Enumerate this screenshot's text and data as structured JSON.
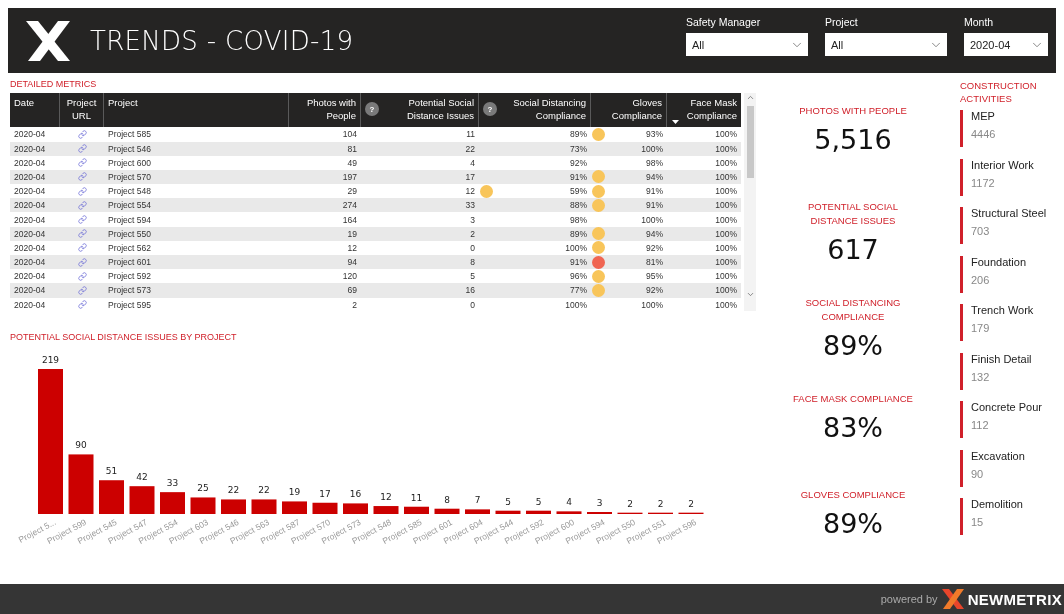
{
  "header": {
    "title": "TRENDS - COVID-19"
  },
  "filters": [
    {
      "label": "Safety Manager",
      "value": "All"
    },
    {
      "label": "Project",
      "value": "All"
    },
    {
      "label": "Month",
      "value": "2020-04"
    }
  ],
  "detailed_metrics": {
    "title": "DETAILED METRICS",
    "columns": [
      {
        "label": "Date",
        "sorted": false
      },
      {
        "label": "Project URL",
        "sorted": false
      },
      {
        "label": "Project",
        "sorted": false
      },
      {
        "label": "Photos with People",
        "sorted": false
      },
      {
        "label": "Potential Social Distance Issues",
        "help": "?",
        "sorted": false
      },
      {
        "label": "Social Distancing Compliance",
        "help": "?",
        "sorted": false
      },
      {
        "label": "Gloves Compliance",
        "sorted": false
      },
      {
        "label": "Face Mask Compliance",
        "sorted": true
      }
    ],
    "rows": [
      {
        "date": "2020-04",
        "project": "Project 585",
        "photos": "104",
        "issues": "11",
        "social_distancing": {
          "text": "89%"
        },
        "gloves": {
          "text": "93%",
          "color": "#f8c55a"
        },
        "face_mask": "100%"
      },
      {
        "date": "2020-04",
        "project": "Project 546",
        "photos": "81",
        "issues": "22",
        "social_distancing": {
          "text": "73%"
        },
        "gloves": {
          "text": "100%"
        },
        "face_mask": "100%"
      },
      {
        "date": "2020-04",
        "project": "Project 600",
        "photos": "49",
        "issues": "4",
        "social_distancing": {
          "text": "92%"
        },
        "gloves": {
          "text": "98%"
        },
        "face_mask": "100%"
      },
      {
        "date": "2020-04",
        "project": "Project 570",
        "photos": "197",
        "issues": "17",
        "social_distancing": {
          "text": "91%"
        },
        "gloves": {
          "text": "94%",
          "color": "#f8c55a"
        },
        "face_mask": "100%"
      },
      {
        "date": "2020-04",
        "project": "Project 548",
        "photos": "29",
        "issues": "12",
        "social_distancing": {
          "text": "59%",
          "color": "#f8c55a"
        },
        "gloves": {
          "text": "91%",
          "color": "#f8c55a"
        },
        "face_mask": "100%"
      },
      {
        "date": "2020-04",
        "project": "Project 554",
        "photos": "274",
        "issues": "33",
        "social_distancing": {
          "text": "88%"
        },
        "gloves": {
          "text": "91%",
          "color": "#f8c55a"
        },
        "face_mask": "100%"
      },
      {
        "date": "2020-04",
        "project": "Project 594",
        "photos": "164",
        "issues": "3",
        "social_distancing": {
          "text": "98%"
        },
        "gloves": {
          "text": "100%"
        },
        "face_mask": "100%"
      },
      {
        "date": "2020-04",
        "project": "Project 550",
        "photos": "19",
        "issues": "2",
        "social_distancing": {
          "text": "89%"
        },
        "gloves": {
          "text": "94%",
          "color": "#f8c55a"
        },
        "face_mask": "100%"
      },
      {
        "date": "2020-04",
        "project": "Project 562",
        "photos": "12",
        "issues": "0",
        "social_distancing": {
          "text": "100%"
        },
        "gloves": {
          "text": "92%",
          "color": "#f8c55a"
        },
        "face_mask": "100%"
      },
      {
        "date": "2020-04",
        "project": "Project 601",
        "photos": "94",
        "issues": "8",
        "social_distancing": {
          "text": "91%"
        },
        "gloves": {
          "text": "81%",
          "color": "#f06552"
        },
        "face_mask": "100%"
      },
      {
        "date": "2020-04",
        "project": "Project 592",
        "photos": "120",
        "issues": "5",
        "social_distancing": {
          "text": "96%"
        },
        "gloves": {
          "text": "95%",
          "color": "#f8c55a"
        },
        "face_mask": "100%"
      },
      {
        "date": "2020-04",
        "project": "Project 573",
        "photos": "69",
        "issues": "16",
        "social_distancing": {
          "text": "77%"
        },
        "gloves": {
          "text": "92%",
          "color": "#f8c55a"
        },
        "face_mask": "100%"
      },
      {
        "date": "2020-04",
        "project": "Project 595",
        "photos": "2",
        "issues": "0",
        "social_distancing": {
          "text": "100%"
        },
        "gloves": {
          "text": "100%"
        },
        "face_mask": "100%"
      }
    ]
  },
  "issues_chart": {
    "title": "POTENTIAL SOCIAL DISTANCE ISSUES BY PROJECT",
    "chart_data": {
      "type": "bar",
      "data_labels": true,
      "categories": [
        "Project 5...",
        "Project 599",
        "Project 545",
        "Project 547",
        "Project 554",
        "Project 603",
        "Project 546",
        "Project 563",
        "Project 587",
        "Project 570",
        "Project 573",
        "Project 548",
        "Project 585",
        "Project 601",
        "Project 604",
        "Project 544",
        "Project 592",
        "Project 600",
        "Project 594",
        "Project 550",
        "Project 551",
        "Project 596"
      ],
      "values": [
        219,
        90,
        51,
        42,
        33,
        25,
        22,
        22,
        19,
        17,
        16,
        12,
        11,
        8,
        7,
        5,
        5,
        4,
        3,
        2,
        2,
        2
      ]
    }
  },
  "kpis": [
    {
      "title": "PHOTOS WITH PEOPLE",
      "value": "5,516"
    },
    {
      "title": "POTENTIAL SOCIAL DISTANCE ISSUES",
      "value": "617"
    },
    {
      "title": "SOCIAL DISTANCING COMPLIANCE",
      "value": "89%"
    },
    {
      "title": "FACE MASK COMPLIANCE",
      "value": "83%"
    },
    {
      "title": "GLOVES COMPLIANCE",
      "value": "89%"
    }
  ],
  "construction_activities": {
    "title": "CONSTRUCTION ACTIVITIES",
    "items": [
      {
        "name": "MEP",
        "count": "4446"
      },
      {
        "name": "Interior Work",
        "count": "1172"
      },
      {
        "name": "Structural Steel",
        "count": "703"
      },
      {
        "name": "Foundation",
        "count": "206"
      },
      {
        "name": "Trench Work",
        "count": "179"
      },
      {
        "name": "Finish Detail",
        "count": "132"
      },
      {
        "name": "Concrete Pour",
        "count": "112"
      },
      {
        "name": "Excavation",
        "count": "90"
      },
      {
        "name": "Demolition",
        "count": "15"
      }
    ]
  },
  "footer": {
    "powered_by": "powered by",
    "brand": "NEWMETRIX"
  }
}
